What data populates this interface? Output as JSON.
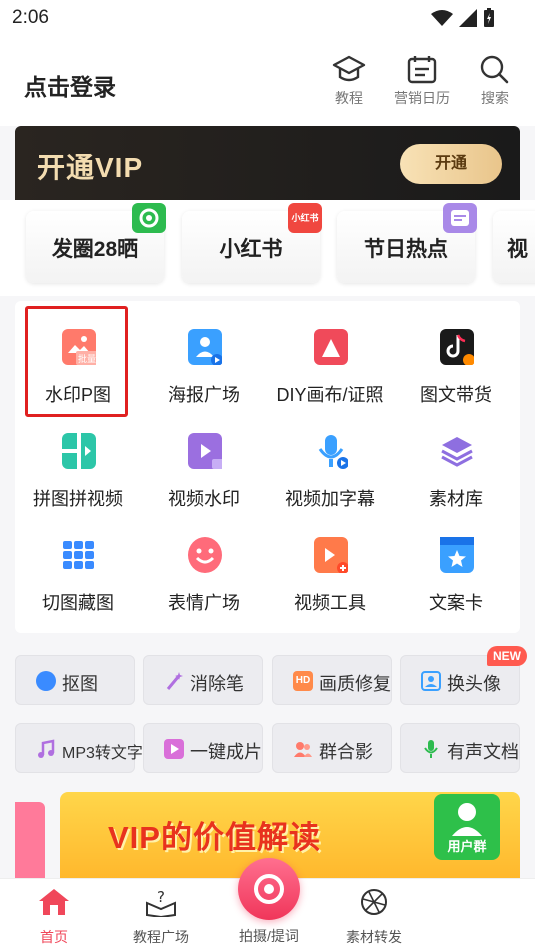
{
  "status": {
    "time": "2:06"
  },
  "header": {
    "login": "点击登录",
    "actions": [
      {
        "label": "教程",
        "icon": "graduation-cap-icon"
      },
      {
        "label": "营销日历",
        "icon": "calendar-icon"
      },
      {
        "label": "搜索",
        "icon": "search-icon"
      }
    ]
  },
  "vip": {
    "title": "开通VIP",
    "button": "开通"
  },
  "chips": [
    {
      "label": "发圈28晒",
      "badge_color": "#2dbb4f"
    },
    {
      "label": "小红书",
      "badge_color": "#f0473f",
      "badge_text": "小红书"
    },
    {
      "label": "节日热点",
      "badge_color": "#a989e8"
    },
    {
      "label": "视"
    }
  ],
  "grid": [
    {
      "label": "水印P图",
      "color": "#ff7a6b",
      "badge": "批量"
    },
    {
      "label": "海报广场",
      "color": "#3aa0ff"
    },
    {
      "label": "DIY画布/证照",
      "color": "#f04a5a"
    },
    {
      "label": "图文带货",
      "color": "#1a1a1a"
    },
    {
      "label": "拼图拼视频",
      "color": "#2cc6a8"
    },
    {
      "label": "视频水印",
      "color": "#9b6fe0"
    },
    {
      "label": "视频加字幕",
      "color": "#3aa0ff"
    },
    {
      "label": "素材库",
      "color": "#8e6fe0"
    },
    {
      "label": "切图藏图",
      "color": "#3a8bff"
    },
    {
      "label": "表情广场",
      "color": "#ff6b7a"
    },
    {
      "label": "视频工具",
      "color": "#ff7a4a"
    },
    {
      "label": "文案卡",
      "color": "#3aa0ff"
    }
  ],
  "tools": [
    {
      "label": "抠图",
      "color": "#3a8bff"
    },
    {
      "label": "消除笔",
      "color": "#b06fe0"
    },
    {
      "label": "画质修复",
      "color": "#ff8a4a",
      "icon_text": "HD"
    },
    {
      "label": "换头像",
      "color": "#3aa0ff",
      "badge": "NEW"
    },
    {
      "label": "MP3转文字",
      "color": "#b06fe0"
    },
    {
      "label": "一键成片",
      "color": "#d96fd9"
    },
    {
      "label": "群合影",
      "color": "#ff7a6b"
    },
    {
      "label": "有声文档",
      "color": "#2dbb4f"
    }
  ],
  "banner": {
    "text": "VIP的价值解读",
    "group_label": "用户群"
  },
  "bottom_nav": [
    {
      "label": "首页",
      "active": true
    },
    {
      "label": "教程广场"
    },
    {
      "label": "拍摄/提词"
    },
    {
      "label": "素材转发"
    }
  ]
}
